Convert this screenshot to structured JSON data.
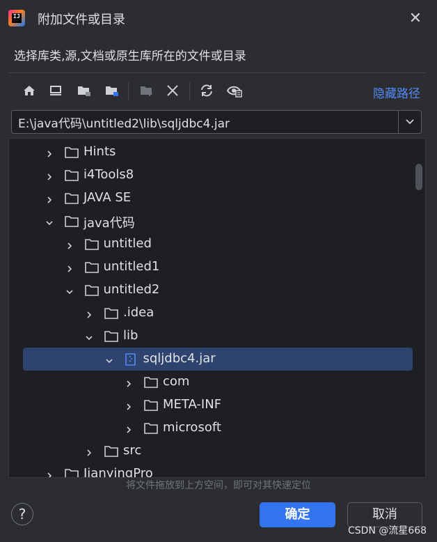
{
  "window": {
    "title": "附加文件或目录"
  },
  "prompt": "选择库类,源,文档或原生库所在的文件或目录",
  "toolbar": {
    "icons": [
      "home-icon",
      "desktop-icon",
      "project-folder-icon",
      "module-folder-icon",
      "new-folder-icon",
      "delete-icon",
      "refresh-icon",
      "show-hidden-icon"
    ],
    "hide_path_label": "隐藏路径"
  },
  "path": {
    "value": "E:\\java代码\\untitled2\\lib\\sqljdbc4.jar"
  },
  "tree": {
    "rows": [
      {
        "label": "Hints",
        "depth": 0,
        "expanded": false,
        "type": "folder"
      },
      {
        "label": "i4Tools8",
        "depth": 0,
        "expanded": false,
        "type": "folder"
      },
      {
        "label": "JAVA SE",
        "depth": 0,
        "expanded": false,
        "type": "folder"
      },
      {
        "label": "java代码",
        "depth": 0,
        "expanded": true,
        "type": "folder"
      },
      {
        "label": "untitled",
        "depth": 1,
        "expanded": false,
        "type": "folder"
      },
      {
        "label": "untitled1",
        "depth": 1,
        "expanded": false,
        "type": "folder"
      },
      {
        "label": "untitled2",
        "depth": 1,
        "expanded": true,
        "type": "folder"
      },
      {
        "label": ".idea",
        "depth": 2,
        "expanded": false,
        "type": "folder"
      },
      {
        "label": "lib",
        "depth": 2,
        "expanded": true,
        "type": "folder"
      },
      {
        "label": "sqljdbc4.jar",
        "depth": 3,
        "expanded": true,
        "type": "jar",
        "selected": true
      },
      {
        "label": "com",
        "depth": 4,
        "expanded": false,
        "type": "folder"
      },
      {
        "label": "META-INF",
        "depth": 4,
        "expanded": false,
        "type": "folder"
      },
      {
        "label": "microsoft",
        "depth": 4,
        "expanded": false,
        "type": "folder"
      },
      {
        "label": "src",
        "depth": 2,
        "expanded": false,
        "type": "folder"
      },
      {
        "label": "JianyingPro",
        "depth": 0,
        "expanded": false,
        "type": "folder"
      }
    ]
  },
  "hint": "将文件拖放到上方空间，即可对其快速定位",
  "buttons": {
    "help": "?",
    "ok": "确定",
    "cancel": "取消"
  },
  "watermark": "CSDN @流星668",
  "colors": {
    "accent": "#3574f0",
    "link": "#548af7",
    "selection": "#2e436e",
    "background": "#2b2d30",
    "tree_background": "#1e1f22"
  }
}
